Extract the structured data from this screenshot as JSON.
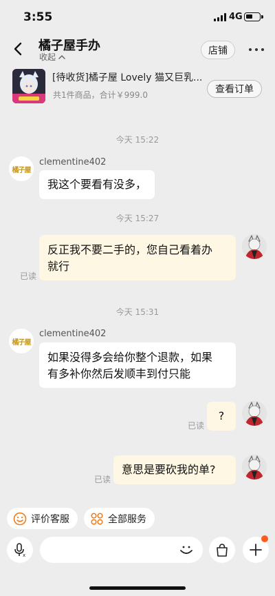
{
  "status_bar": {
    "time": "3:55",
    "network": "4G"
  },
  "header": {
    "title": "橘子屋手办",
    "collapse_label": "收起",
    "store_button": "店铺"
  },
  "order": {
    "title": "[待收货]橘子屋 Lovely 猫又巨乳...",
    "summary": "共1件商品，合计￥999.0",
    "view_order_button": "查看订单"
  },
  "chat": {
    "shop_avatar_text": "橘子屋",
    "groups": [
      {
        "time": "今天 15:22"
      },
      {
        "time": "今天 15:27"
      },
      {
        "time": "今天 15:31"
      }
    ],
    "messages": [
      {
        "sender": "clementine402",
        "text": "我这个要看有没多，"
      },
      {
        "text_line1": "反正我不要二手的，您自己看着办",
        "text_line2": "就行",
        "read": "已读"
      },
      {
        "sender": "clementine402",
        "text_line1": "如果没得多会给你整个退款，如果",
        "text_line2": "有多补你然后发顺丰到付只能"
      },
      {
        "text": "?",
        "read": "已读"
      },
      {
        "text": "意思是要砍我的单?",
        "read": "已读"
      }
    ]
  },
  "quick_actions": [
    {
      "label": "评价客服",
      "icon": "smile-icon"
    },
    {
      "label": "全部服务",
      "icon": "grid-icon"
    }
  ],
  "input": {
    "placeholder": ""
  },
  "colors": {
    "background": "#ededed",
    "incoming_bubble": "#ffffff",
    "outgoing_bubble": "#fdf7e4",
    "accent": "#ff5b1a",
    "brand_gold": "#c89a1c"
  }
}
